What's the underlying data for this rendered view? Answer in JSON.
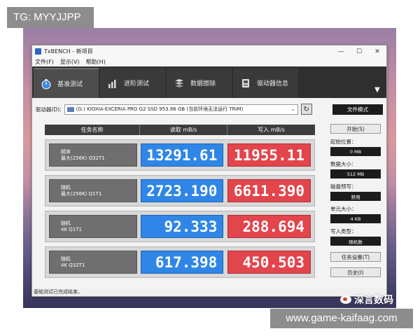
{
  "watermarks": {
    "top_tag": "TG: MYYJJPP",
    "bottom_tag": "www.game-kaifaag.com",
    "weibo": "深言数码"
  },
  "window": {
    "title": "TxBENCH - 新项目",
    "controls": [
      "—",
      "☐",
      "✕"
    ],
    "menu": [
      "文件(F)",
      "显示(V)",
      "帮助(H)"
    ]
  },
  "toolbar": {
    "tabs": [
      {
        "label": "基准测试",
        "icon": "stopwatch-icon",
        "active": true
      },
      {
        "label": "进阶测试",
        "icon": "bar-chart-icon",
        "active": false
      },
      {
        "label": "数据擦除",
        "icon": "layers-icon",
        "active": false
      },
      {
        "label": "驱动器信息",
        "icon": "drive-info-icon",
        "active": false
      }
    ],
    "more": "▼"
  },
  "drive": {
    "label": "驱动器(D):",
    "value": "(G:) KIOXIA-EXCERIA PRO G2 SSD  953.86 GB (当前环境无法运行 TRIM)",
    "file_mode": "文件模式"
  },
  "results": {
    "headers": [
      "任务名称",
      "读取 mB/s",
      "写入 mB/s"
    ],
    "rows": [
      {
        "line1": "顺序",
        "line2": "最大(256K) Q32T1",
        "read": "13291.61",
        "write": "11955.11"
      },
      {
        "line1": "随机",
        "line2": "最大(256K) Q1T1",
        "read": "2723.190",
        "write": "6611.390"
      },
      {
        "line1": "随机",
        "line2": "4K Q1T1",
        "read": "92.333",
        "write": "288.694"
      },
      {
        "line1": "随机",
        "line2": "4K Q32T1",
        "read": "617.398",
        "write": "450.503"
      }
    ]
  },
  "side": {
    "start": "开始(S)",
    "start_pos_label": "起始位置：",
    "start_pos": "0 MB",
    "data_size_label": "数据大小：",
    "data_size": "512 MB",
    "precondition_label": "磁盘预写：",
    "precondition": "禁用",
    "unit_size_label": "单元大小：",
    "unit_size": "4 KB",
    "write_type_label": "写入类型：",
    "write_type": "随机数",
    "task_settings": "任务设置(T)",
    "history": "历史(I)"
  },
  "status": "基础测试已完成结束。"
}
